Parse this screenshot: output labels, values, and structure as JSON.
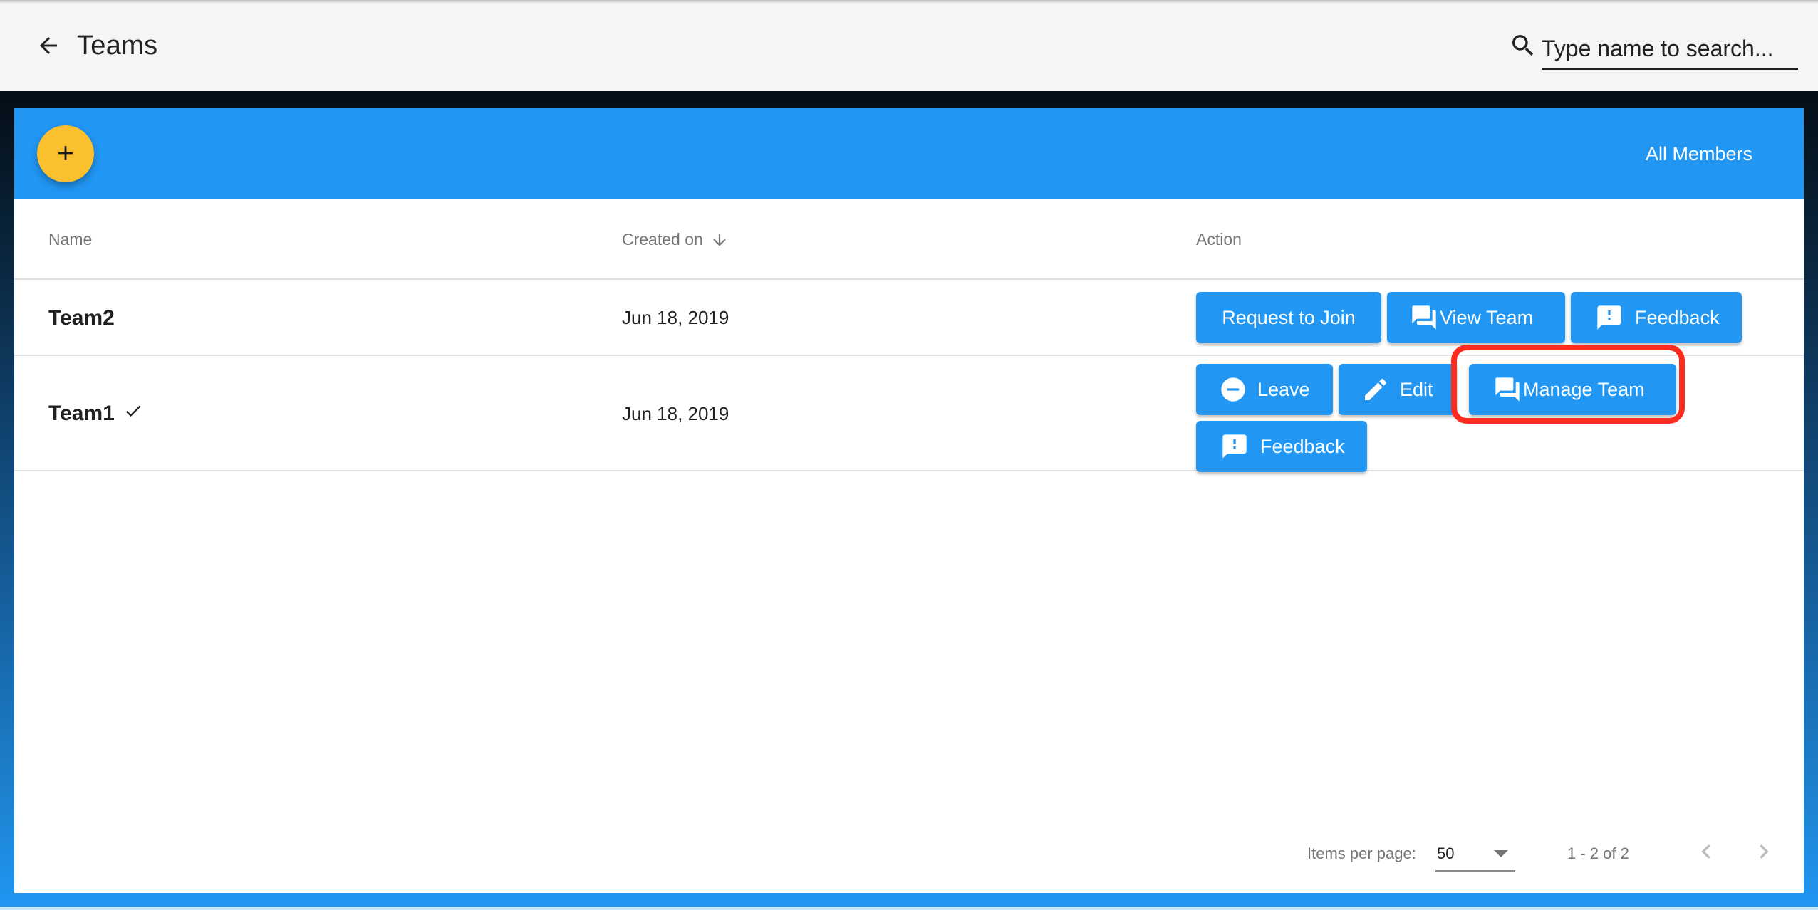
{
  "header": {
    "title": "Teams",
    "back_icon": "arrow-back-icon",
    "search": {
      "icon": "search-icon",
      "placeholder": "Type name to search...",
      "value": ""
    }
  },
  "toolbar": {
    "add_button_icon": "plus-icon",
    "add_button_color": "#fbc02d",
    "all_members_label": "All Members",
    "background_color": "#2196f3"
  },
  "table": {
    "columns": [
      {
        "label": "Name"
      },
      {
        "label": "Created on",
        "sort": "descending",
        "sort_icon": "arrow-down-icon"
      },
      {
        "label": "Action"
      }
    ],
    "rows": [
      {
        "name": "Team2",
        "member": false,
        "created_on": "Jun 18, 2019",
        "actions": [
          {
            "label": "Request to Join",
            "icon": null
          },
          {
            "label": "View Team",
            "icon": "forum-icon"
          },
          {
            "label": "Feedback",
            "icon": "feedback-icon"
          }
        ]
      },
      {
        "name": "Team1",
        "member": true,
        "member_icon": "check-icon",
        "created_on": "Jun 18, 2019",
        "actions": [
          {
            "label": "Leave",
            "icon": "remove-circle-icon"
          },
          {
            "label": "Edit",
            "icon": "pencil-icon"
          },
          {
            "label": "Manage Team",
            "icon": "forum-icon",
            "highlighted": true
          },
          {
            "label": "Feedback",
            "icon": "feedback-icon"
          }
        ]
      }
    ]
  },
  "paginator": {
    "items_per_page_label": "Items per page:",
    "items_per_page_value": "50",
    "range_label": "1 - 2 of 2",
    "prev_icon": "chevron-left-icon",
    "next_icon": "chevron-right-icon",
    "prev_disabled": true,
    "next_disabled": true
  },
  "colors": {
    "primary": "#2196f3",
    "accent": "#fbc02d",
    "highlight": "#ff2b1f"
  }
}
